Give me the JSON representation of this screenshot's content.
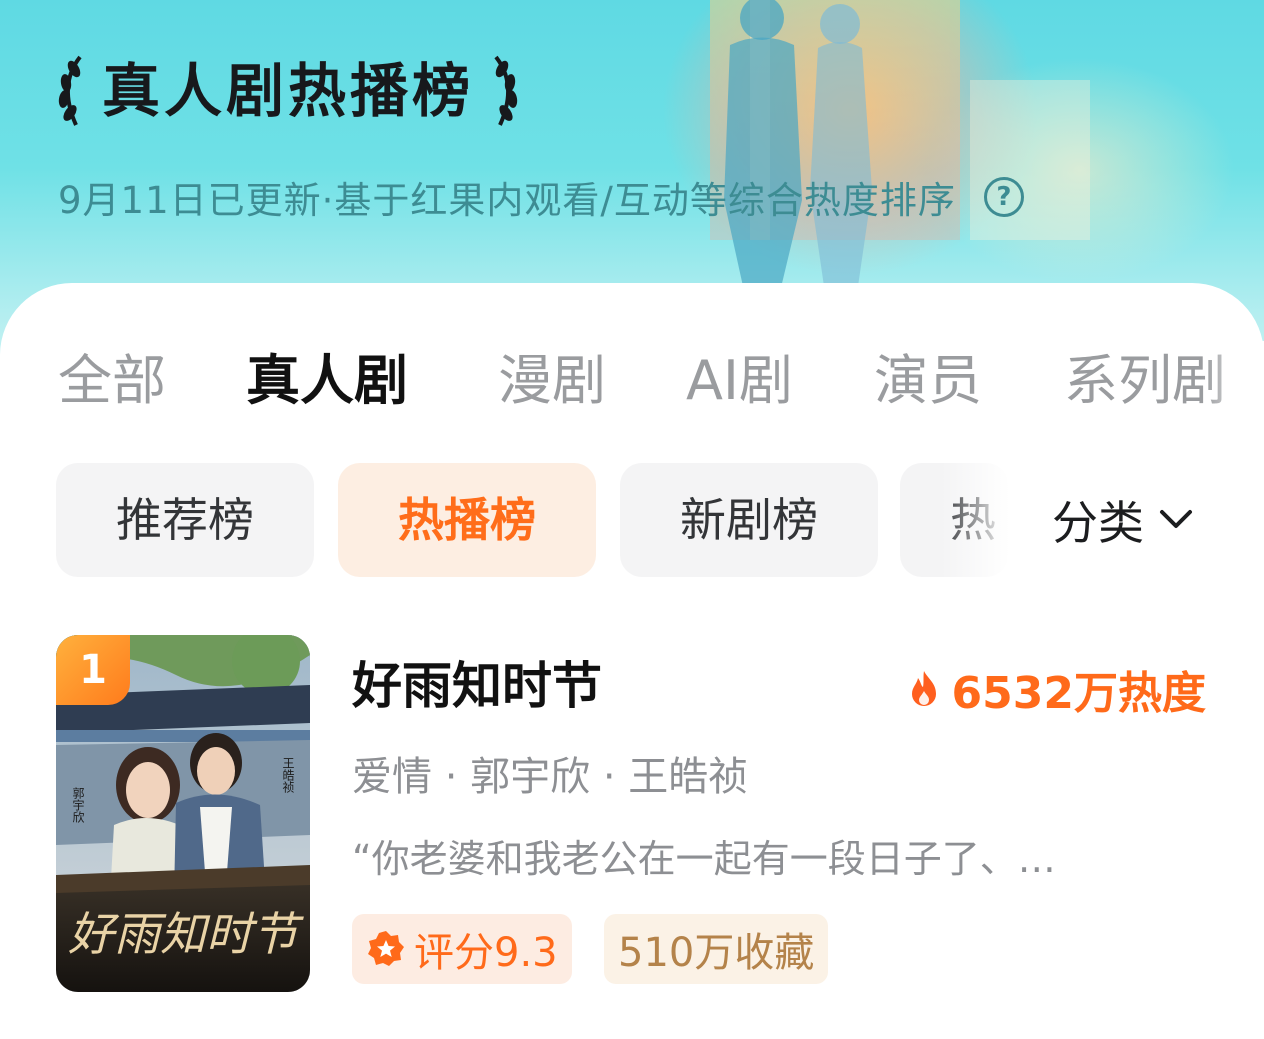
{
  "header": {
    "title": "真人剧热播榜",
    "subtitle": "9月11日已更新·基于红果内观看/互动等综合热度排序",
    "help_icon_glyph": "?"
  },
  "tabs": [
    {
      "label": "全部",
      "active": false
    },
    {
      "label": "真人剧",
      "active": true
    },
    {
      "label": "漫剧",
      "active": false
    },
    {
      "label": "AI剧",
      "active": false
    },
    {
      "label": "演员",
      "active": false
    },
    {
      "label": "系列剧",
      "active": false
    }
  ],
  "chips": [
    {
      "label": "推荐榜",
      "active": false
    },
    {
      "label": "热播榜",
      "active": true
    },
    {
      "label": "新剧榜",
      "active": false
    },
    {
      "label": "热",
      "active": false
    }
  ],
  "category": {
    "label": "分类",
    "icon": "chevron-down-icon"
  },
  "items": [
    {
      "rank": "1",
      "title": "好雨知时节",
      "heat": "6532万热度",
      "meta": "爱情 · 郭宇欣 · 王皓祯",
      "quote": "“你老婆和我老公在一起有一段日子了、…",
      "score": "评分9.3",
      "favorites": "510万收藏",
      "poster": {
        "calligraphy": "好雨知时节",
        "actor_left": "郭宇欣",
        "actor_right": "王皓祯"
      }
    }
  ],
  "colors": {
    "accent": "#ff6a1a",
    "header_bg": "#6fe1e6",
    "subtitle": "#3d8c93",
    "tab_inactive": "#9a9c9f",
    "chip_active_bg": "#fdeee2"
  }
}
